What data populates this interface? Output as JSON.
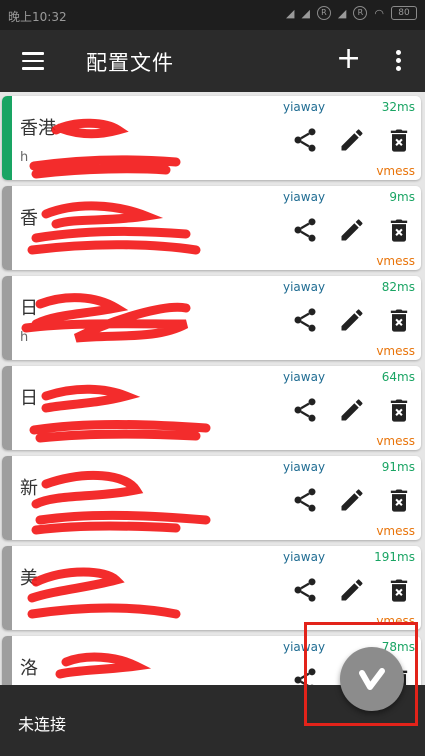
{
  "statusbar": {
    "time": "晚上10:32",
    "icon_r1": "R",
    "icon_r2": "R",
    "battery": "80"
  },
  "toolbar": {
    "title": "配置文件",
    "add_icon": "plus-icon",
    "more_icon": "more-vert-icon",
    "menu_icon": "menu-icon"
  },
  "colors": {
    "active": "#19a463",
    "inactive": "#9e9e9e",
    "group": "#1f6c92",
    "latency": "#19a463",
    "protocol": "#e8740a",
    "redaction": "#f21a1a"
  },
  "servers": [
    {
      "name": "香港",
      "address": "h",
      "group": "yiaway",
      "latency": "32ms",
      "protocol": "vmess",
      "active": true
    },
    {
      "name": "香",
      "address": "",
      "group": "yiaway",
      "latency": "9ms",
      "protocol": "vmess",
      "active": false
    },
    {
      "name": "日",
      "address": "h",
      "group": "yiaway",
      "latency": "82ms",
      "protocol": "vmess",
      "active": false
    },
    {
      "name": "日",
      "address": "",
      "group": "yiaway",
      "latency": "64ms",
      "protocol": "vmess",
      "active": false
    },
    {
      "name": "新",
      "address": "",
      "group": "yiaway",
      "latency": "91ms",
      "protocol": "vmess",
      "active": false
    },
    {
      "name": "美",
      "address": "",
      "group": "yiaway",
      "latency": "191ms",
      "protocol": "vmess",
      "active": false
    },
    {
      "name": "洛",
      "address": "",
      "group": "yiaway",
      "latency": "78ms",
      "protocol": "",
      "active": false
    }
  ],
  "bottombar": {
    "status": "未连接"
  },
  "fab": {
    "icon": "v-logo-icon"
  }
}
